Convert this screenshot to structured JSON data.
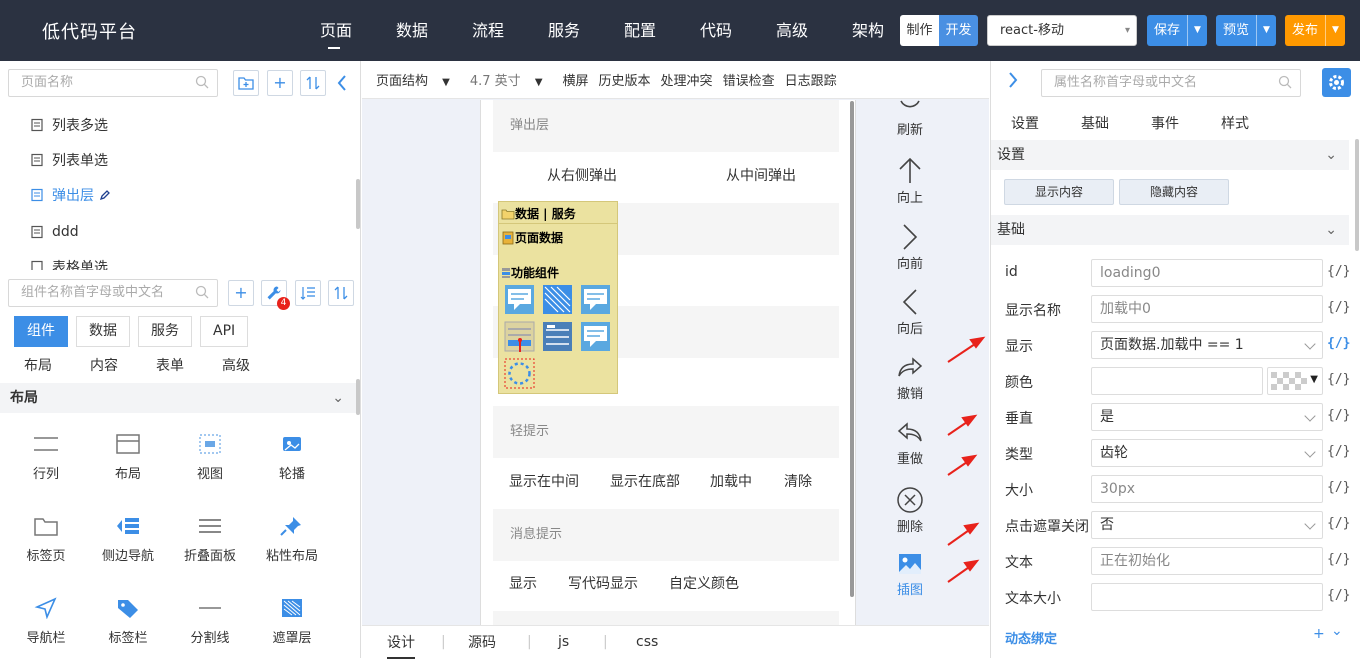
{
  "app": {
    "title": "低代码平台"
  },
  "nav": {
    "items": [
      "页面",
      "数据",
      "流程",
      "服务",
      "配置",
      "代码",
      "高级",
      "架构"
    ],
    "active": "页面"
  },
  "mode": {
    "make": "制作",
    "dev": "开发"
  },
  "target": {
    "selected": "react-移动"
  },
  "actions": {
    "save": "保存",
    "preview": "预览",
    "publish": "发布"
  },
  "left": {
    "page_search_placeholder": "页面名称",
    "pages": [
      "列表多选",
      "列表单选",
      "弹出层",
      "ddd",
      "表格单选"
    ],
    "selected_page": "弹出层",
    "comp_search_placeholder": "组件名称首字母或中文名",
    "badge_count": "4",
    "tabs": [
      "组件",
      "数据",
      "服务",
      "API"
    ],
    "subtabs": [
      "布局",
      "内容",
      "表单",
      "高级"
    ],
    "section": "布局",
    "components": [
      "行列",
      "布局",
      "视图",
      "轮播",
      "标签页",
      "侧边导航",
      "折叠面板",
      "粘性布局",
      "导航栏",
      "标签栏",
      "分割线",
      "遮罩层"
    ]
  },
  "center": {
    "toolbar": {
      "structure": "页面结构",
      "size": "4.7 英寸",
      "landscape": "横屏",
      "history": "历史版本",
      "conflict": "处理冲突",
      "check": "错误检查",
      "log": "日志跟踪"
    },
    "phone": {
      "popup_header": "弹出层",
      "popup_right": "从右侧弹出",
      "popup_center": "从中间弹出",
      "toast_header": "轻提示",
      "toast_items": [
        "显示在中间",
        "显示在底部",
        "加载中",
        "清除"
      ],
      "msg_header": "消息提示",
      "msg_items": [
        "显示",
        "写代码显示",
        "自定义颜色"
      ]
    },
    "float_panel": {
      "title": "数据 | 服务",
      "page_data": "页面数据",
      "func": "功能组件"
    },
    "ops": [
      "刷新",
      "向上",
      "向前",
      "向后",
      "撤销",
      "重做",
      "删除",
      "插图"
    ],
    "bottom_tabs": [
      "设计",
      "源码",
      "js",
      "css"
    ]
  },
  "right": {
    "search_placeholder": "属性名称首字母或中文名",
    "tabs": [
      "设置",
      "基础",
      "事件",
      "样式"
    ],
    "settings_section": "设置",
    "show_btn": "显示内容",
    "hide_btn": "隐藏内容",
    "basic_section": "基础",
    "props": [
      {
        "label": "id",
        "value": "loading0"
      },
      {
        "label": "显示名称",
        "value": "加载中0"
      },
      {
        "label": "显示",
        "value": "页面数据.加载中 == 1"
      },
      {
        "label": "颜色",
        "value": ""
      },
      {
        "label": "垂直",
        "value": "是"
      },
      {
        "label": "类型",
        "value": "齿轮"
      },
      {
        "label": "大小",
        "value": "30px"
      },
      {
        "label": "点击遮罩关闭",
        "value": "否"
      },
      {
        "label": "文本",
        "value": "正在初始化"
      },
      {
        "label": "文本大小",
        "value": ""
      }
    ],
    "bind_label": "{/}",
    "dynamic_binding": "动态绑定",
    "plus": "+"
  },
  "colors": {
    "topbar": "#2b3241",
    "accent": "#3c8ee6",
    "publish": "#ff9900",
    "arrow": "#e8221b"
  }
}
